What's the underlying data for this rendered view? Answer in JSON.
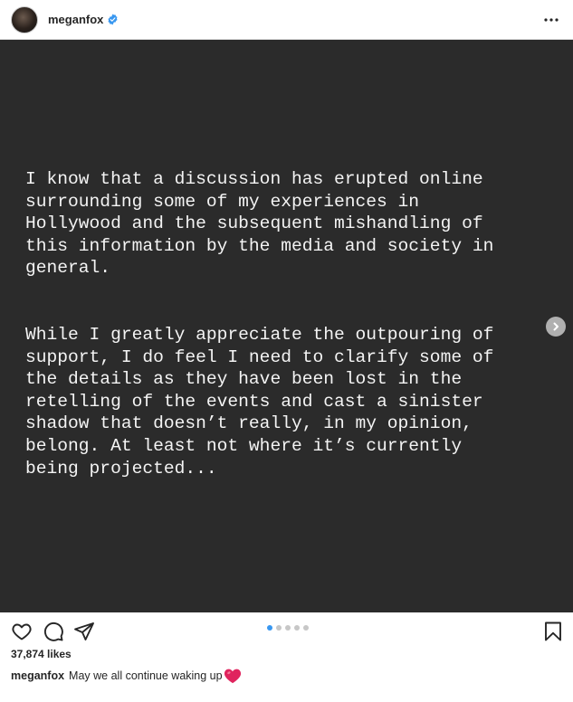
{
  "header": {
    "username": "meganfox",
    "verified": true,
    "avatar_icon": "profile-avatar",
    "more_icon": "more-horizontal-icon"
  },
  "post": {
    "background_color": "#2b2b2b",
    "text_color": "#f4f4f4",
    "paragraph_1": "I know that a discussion has erupted online\nsurrounding some of my experiences in\nHollywood and the subsequent mishandling of\nthis information by the media and society in\ngeneral.",
    "paragraph_2": "While I greatly appreciate the outpouring of\nsupport, I do feel I need to clarify some of\nthe details as they have been lost in the\nretelling of the events and cast a sinister\nshadow that doesn’t really, in my opinion,\nbelong. At least not where it’s currently\nbeing projected...",
    "carousel": {
      "total": 5,
      "active": 1
    }
  },
  "actions": {
    "like_icon": "heart-outline-icon",
    "comment_icon": "comment-icon",
    "share_icon": "paper-plane-icon",
    "save_icon": "bookmark-icon",
    "next_icon": "chevron-right-icon"
  },
  "likes": "37,874 likes",
  "caption": {
    "username": "meganfox",
    "text": "May we all continue waking up",
    "emoji_icon": "red-heart-emoji"
  },
  "colors": {
    "accent": "#3897f0",
    "verified": "#3897f0",
    "heart": "#e0245e"
  }
}
